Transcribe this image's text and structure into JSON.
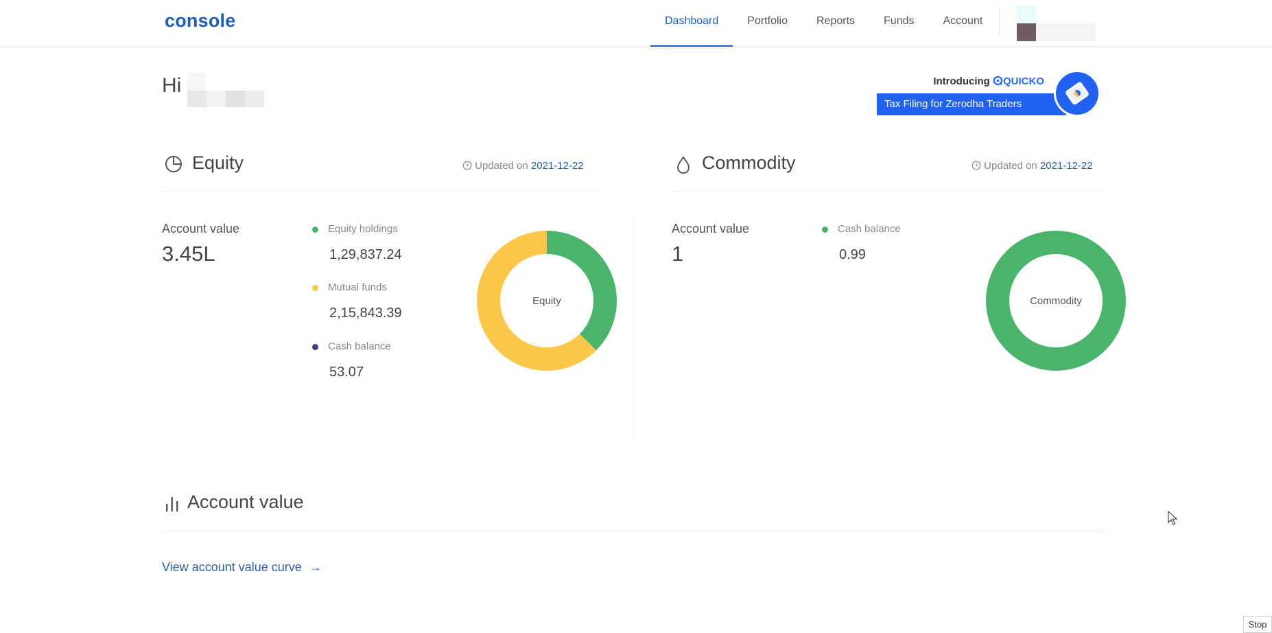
{
  "header": {
    "logo": "console",
    "nav": [
      {
        "label": "Dashboard",
        "active": true
      },
      {
        "label": "Portfolio",
        "active": false
      },
      {
        "label": "Reports",
        "active": false
      },
      {
        "label": "Funds",
        "active": false
      },
      {
        "label": "Account",
        "active": false
      }
    ]
  },
  "greeting": {
    "prefix": "Hi"
  },
  "banner": {
    "intro": "Introducing",
    "brand": "QUICKO",
    "tagline": "Tax Filing for Zerodha Traders"
  },
  "equity": {
    "title": "Equity",
    "updated_prefix": "Updated on",
    "updated_date": "2021-12-22",
    "account_value_label": "Account value",
    "account_value": "3.45L",
    "legend": [
      {
        "label": "Equity holdings",
        "value": "1,29,837.24",
        "color": "#4bb46b"
      },
      {
        "label": "Mutual funds",
        "value": "2,15,843.39",
        "color": "#fdc84a"
      },
      {
        "label": "Cash balance",
        "value": "53.07",
        "color": "#3f3f7a"
      }
    ],
    "donut_label": "Equity"
  },
  "commodity": {
    "title": "Commodity",
    "updated_prefix": "Updated on",
    "updated_date": "2021-12-22",
    "account_value_label": "Account value",
    "account_value": "1",
    "legend": [
      {
        "label": "Cash balance",
        "value": "0.99",
        "color": "#4bb46b"
      }
    ],
    "donut_label": "Commodity"
  },
  "account_value_section": {
    "title": "Account value",
    "link": "View account value curve",
    "link_arrow": "→"
  },
  "misc": {
    "stop_label": "Stop"
  },
  "chart_data": [
    {
      "type": "pie",
      "categories": [
        "Equity holdings",
        "Mutual funds",
        "Cash balance"
      ],
      "values": [
        129837.24,
        215843.39,
        53.07
      ],
      "colors": [
        "#4bb46b",
        "#fdc84a",
        "#3f3f7a"
      ],
      "title": "",
      "center_label": "Equity"
    },
    {
      "type": "pie",
      "categories": [
        "Cash balance"
      ],
      "values": [
        0.99
      ],
      "colors": [
        "#4bb46b"
      ],
      "title": "",
      "center_label": "Commodity"
    }
  ]
}
